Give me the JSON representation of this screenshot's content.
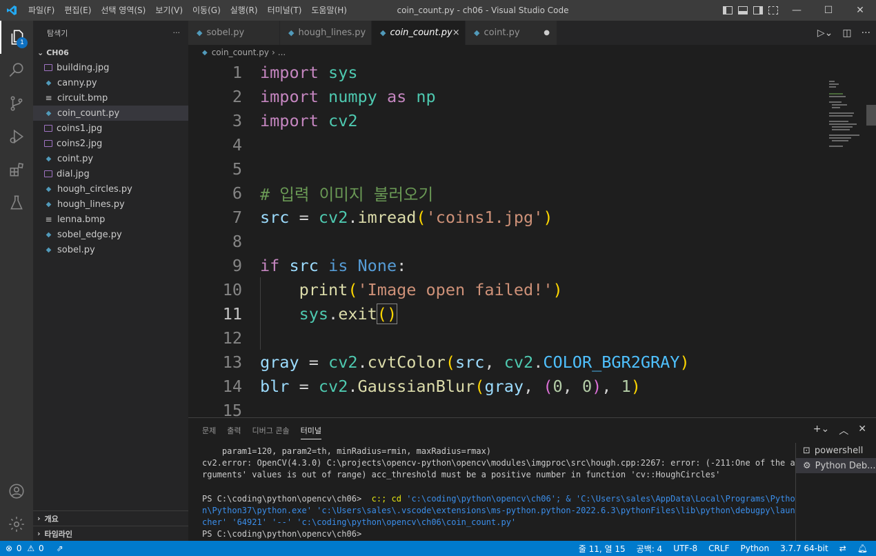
{
  "window": {
    "title": "coin_count.py - ch06 - Visual Studio Code"
  },
  "menu": [
    "파일(F)",
    "편집(E)",
    "선택 영역(S)",
    "보기(V)",
    "이동(G)",
    "실행(R)",
    "터미널(T)",
    "도움말(H)"
  ],
  "activity": {
    "badge": "1",
    "icons": [
      "explorer-icon",
      "search-icon",
      "source-control-icon",
      "run-debug-icon",
      "extensions-icon",
      "testing-icon",
      "account-icon",
      "settings-gear-icon"
    ]
  },
  "explorer": {
    "title": "탐색기",
    "more": "···",
    "folder": "CH06",
    "files": [
      {
        "name": "building.jpg",
        "type": "img"
      },
      {
        "name": "canny.py",
        "type": "py"
      },
      {
        "name": "circuit.bmp",
        "type": "bmp"
      },
      {
        "name": "coin_count.py",
        "type": "py",
        "selected": true
      },
      {
        "name": "coins1.jpg",
        "type": "img"
      },
      {
        "name": "coins2.jpg",
        "type": "img"
      },
      {
        "name": "coint.py",
        "type": "py"
      },
      {
        "name": "dial.jpg",
        "type": "img"
      },
      {
        "name": "hough_circles.py",
        "type": "py"
      },
      {
        "name": "hough_lines.py",
        "type": "py"
      },
      {
        "name": "lenna.bmp",
        "type": "bmp"
      },
      {
        "name": "sobel_edge.py",
        "type": "py"
      },
      {
        "name": "sobel.py",
        "type": "py"
      }
    ],
    "outline": "개요",
    "timeline": "타임라인"
  },
  "tabs": [
    {
      "label": "sobel.py"
    },
    {
      "label": "hough_lines.py"
    },
    {
      "label": "coin_count.py",
      "active": true,
      "close": "×"
    },
    {
      "label": "coint.py",
      "dirty": "●"
    }
  ],
  "breadcrumb": {
    "file": "coin_count.py",
    "sep": "›",
    "rest": "..."
  },
  "code": {
    "line_numbers": [
      "1",
      "2",
      "3",
      "4",
      "5",
      "6",
      "7",
      "8",
      "9",
      "10",
      "11",
      "12",
      "13",
      "14",
      "15"
    ],
    "current_line": "11",
    "lines": [
      [
        [
          "kw",
          "import"
        ],
        [
          "op",
          " "
        ],
        [
          "id",
          "sys"
        ]
      ],
      [
        [
          "kw",
          "import"
        ],
        [
          "op",
          " "
        ],
        [
          "id",
          "numpy"
        ],
        [
          "op",
          " "
        ],
        [
          "kw",
          "as"
        ],
        [
          "op",
          " "
        ],
        [
          "id",
          "np"
        ]
      ],
      [
        [
          "kw",
          "import"
        ],
        [
          "op",
          " "
        ],
        [
          "id",
          "cv2"
        ]
      ],
      [],
      [],
      [
        [
          "cm",
          "# 입력 이미지 불러오기"
        ]
      ],
      [
        [
          "var",
          "src"
        ],
        [
          "op",
          " = "
        ],
        [
          "id",
          "cv2"
        ],
        [
          "op",
          "."
        ],
        [
          "fn",
          "imread"
        ],
        [
          "br",
          "("
        ],
        [
          "str",
          "'coins1.jpg'"
        ],
        [
          "br",
          ")"
        ]
      ],
      [],
      [
        [
          "kw",
          "if"
        ],
        [
          "op",
          " "
        ],
        [
          "var",
          "src"
        ],
        [
          "op",
          " "
        ],
        [
          "kb",
          "is"
        ],
        [
          "op",
          " "
        ],
        [
          "kb",
          "None"
        ],
        [
          "op",
          ":"
        ]
      ],
      [
        [
          "op",
          "    "
        ],
        [
          "fn",
          "print"
        ],
        [
          "br",
          "("
        ],
        [
          "str",
          "'Image open failed!'"
        ],
        [
          "br",
          ")"
        ]
      ],
      [
        [
          "op",
          "    "
        ],
        [
          "id",
          "sys"
        ],
        [
          "op",
          "."
        ],
        [
          "fn",
          "exit"
        ],
        [
          "br",
          "()"
        ]
      ],
      [],
      [
        [
          "var",
          "gray"
        ],
        [
          "op",
          " = "
        ],
        [
          "id",
          "cv2"
        ],
        [
          "op",
          "."
        ],
        [
          "fn",
          "cvtColor"
        ],
        [
          "br",
          "("
        ],
        [
          "var",
          "src"
        ],
        [
          "op",
          ", "
        ],
        [
          "id",
          "cv2"
        ],
        [
          "op",
          "."
        ],
        [
          "const",
          "COLOR_BGR2GRAY"
        ],
        [
          "br",
          ")"
        ]
      ],
      [
        [
          "var",
          "blr"
        ],
        [
          "op",
          " = "
        ],
        [
          "id",
          "cv2"
        ],
        [
          "op",
          "."
        ],
        [
          "fn",
          "GaussianBlur"
        ],
        [
          "br",
          "("
        ],
        [
          "var",
          "gray"
        ],
        [
          "op",
          ", "
        ],
        [
          "br2",
          "("
        ],
        [
          "num2",
          "0"
        ],
        [
          "op",
          ", "
        ],
        [
          "num2",
          "0"
        ],
        [
          "br2",
          ")"
        ],
        [
          "op",
          ", "
        ],
        [
          "num2",
          "1"
        ],
        [
          "br",
          ")"
        ]
      ],
      []
    ]
  },
  "panel": {
    "tabs": [
      "문제",
      "출력",
      "디버그 콘솔",
      "터미널"
    ],
    "active": "터미널",
    "terminal": [
      "    param1=120, param2=th, minRadius=rmin, maxRadius=rmax)",
      "cv2.error: OpenCV(4.3.0) C:\\projects\\opencv-python\\opencv\\modules\\imgproc\\src\\hough.cpp:2267: error: (-211:One of the a",
      "rguments' values is out of range) acc_threshold must be a positive number in function 'cv::HoughCircles'",
      "",
      "PS C:\\coding\\python\\opencv\\ch06>  c:; cd 'c:\\coding\\python\\opencv\\ch06'; & 'C:\\Users\\sales\\AppData\\Local\\Programs\\Pytho",
      "n\\Python37\\python.exe' 'c:\\Users\\sales\\.vscode\\extensions\\ms-python.python-2022.6.3\\pythonFiles\\lib\\python\\debugpy\\laun",
      "cher' '64921' '--' 'c:\\coding\\python\\opencv\\ch06\\coin_count.py'",
      "PS C:\\coding\\python\\opencv\\ch06> "
    ],
    "terminals": [
      {
        "name": "powershell"
      },
      {
        "name": "Python Deb...",
        "selected": true
      }
    ]
  },
  "status": {
    "errors": "0",
    "warnings": "0",
    "position": "줄 11, 열 15",
    "indent": "공백: 4",
    "encoding": "UTF-8",
    "eol": "CRLF",
    "language": "Python",
    "interpreter": "3.7.7 64-bit"
  },
  "colors": {
    "accent": "#007acc",
    "titlebar": "#3c3c3c",
    "sidebar": "#252526",
    "editor": "#1e1e1e"
  }
}
